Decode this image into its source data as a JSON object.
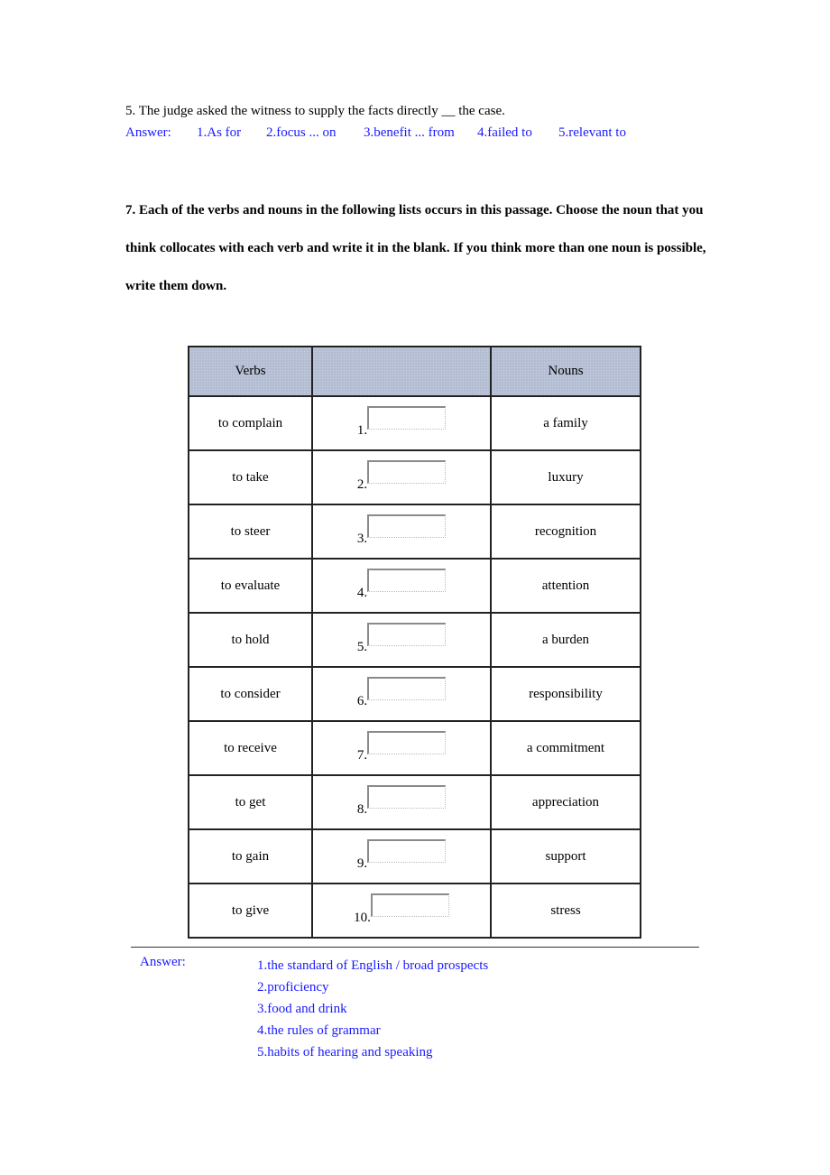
{
  "question5": {
    "text": "5. The judge asked the witness to supply the facts directly __ the case."
  },
  "answer_section_1": {
    "label": "Answer:",
    "items": [
      "1.As for",
      "2.focus ... on",
      "3.benefit ... from",
      "4.failed to",
      "5.relevant to"
    ]
  },
  "question7": {
    "instructions": "7. Each of the verbs and nouns in the following lists occurs in this passage. Choose the noun that you think collocates with each verb and write it in the blank. If you think more than one noun is possible, write them down."
  },
  "table": {
    "headers": [
      "Verbs",
      "",
      "Nouns"
    ],
    "header_bg": "#b4bed3",
    "rows": [
      {
        "verb": "to complain",
        "num": "1.",
        "value": "",
        "noun": "a family"
      },
      {
        "verb": "to take",
        "num": "2.",
        "value": "",
        "noun": "luxury"
      },
      {
        "verb": "to steer",
        "num": "3.",
        "value": "",
        "noun": "recognition"
      },
      {
        "verb": "to evaluate",
        "num": "4.",
        "value": "",
        "noun": "attention"
      },
      {
        "verb": "to hold",
        "num": "5.",
        "value": "",
        "noun": "a burden"
      },
      {
        "verb": "to consider",
        "num": "6.",
        "value": "",
        "noun": "responsibility"
      },
      {
        "verb": "to receive",
        "num": "7.",
        "value": "",
        "noun": "a commitment"
      },
      {
        "verb": "to get",
        "num": "8.",
        "value": "",
        "noun": "appreciation"
      },
      {
        "verb": "to gain",
        "num": "9.",
        "value": "",
        "noun": "support"
      },
      {
        "verb": "to give",
        "num": "10.",
        "value": "",
        "noun": "stress"
      }
    ]
  },
  "answer_section_2": {
    "label": "Answer:",
    "items": [
      "1.the standard of English / broad prospects",
      "2.proficiency",
      "3.food and drink",
      "4.the rules of grammar",
      "5.habits of hearing and speaking"
    ]
  },
  "colors": {
    "answer_text": "#1a1aff"
  }
}
